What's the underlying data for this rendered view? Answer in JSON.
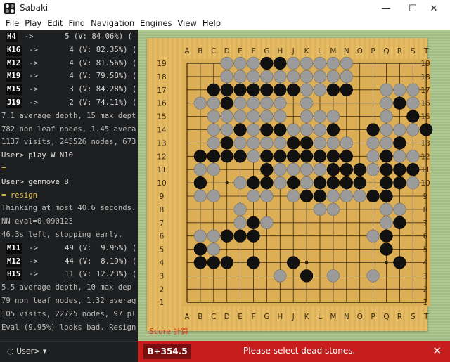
{
  "window": {
    "title": "Sabaki",
    "minimize": "—",
    "maximize": "☐",
    "close": "✕"
  },
  "menu": [
    "File",
    "Play",
    "Edit",
    "Find",
    "Navigation",
    "Engines",
    "View",
    "Help"
  ],
  "console": {
    "lines": [
      {
        "kind": "mv",
        "move": "H4",
        "text": "->       5 (V: 84.06%) ("
      },
      {
        "kind": "mv",
        "move": "K16",
        "text": "->       4 (V: 82.35%) ("
      },
      {
        "kind": "mv",
        "move": "M12",
        "text": "->       4 (V: 81.56%) ("
      },
      {
        "kind": "mv",
        "move": "M19",
        "text": "->       4 (V: 79.58%) ("
      },
      {
        "kind": "mv",
        "move": "M15",
        "text": "->       3 (V: 84.28%) ("
      },
      {
        "kind": "mv",
        "move": "J19",
        "text": "->       2 (V: 74.11%) ("
      },
      {
        "kind": "dim",
        "text": "7.1 average depth, 15 max dept"
      },
      {
        "kind": "dim",
        "text": "782 non leaf nodes, 1.45 avera"
      },
      {
        "kind": "dim",
        "text": "1137 visits, 245526 nodes, 673"
      },
      {
        "kind": "usr",
        "text": "User> play W N10"
      },
      {
        "kind": "eq",
        "text": "="
      },
      {
        "kind": "usr",
        "text": "User> genmove B"
      },
      {
        "kind": "resp",
        "text": "= resign"
      },
      {
        "kind": "dim",
        "text": "Thinking at most 40.6 seconds."
      },
      {
        "kind": "dim",
        "text": "NN eval=0.090123"
      },
      {
        "kind": "dim",
        "text": "46.3s left, stopping early."
      },
      {
        "kind": "mv",
        "move": "M11",
        "text": "->      49 (V:  9.95%) ("
      },
      {
        "kind": "mv",
        "move": "M12",
        "text": "->      44 (V:  8.19%) ("
      },
      {
        "kind": "mv",
        "move": "H15",
        "text": "->      11 (V: 12.23%) ("
      },
      {
        "kind": "dim",
        "text": "5.5 average depth, 10 max dep"
      },
      {
        "kind": "dim",
        "text": "79 non leaf nodes, 1.32 averag"
      },
      {
        "kind": "dim",
        "text": "105 visits, 22725 nodes, 97 pl"
      },
      {
        "kind": "dim",
        "text": "Eval (9.95%) looks bad. Resign"
      }
    ],
    "prompt": "○ User> ▾"
  },
  "board": {
    "size": 19,
    "columns": [
      "A",
      "B",
      "C",
      "D",
      "E",
      "F",
      "G",
      "H",
      "J",
      "K",
      "L",
      "M",
      "N",
      "O",
      "P",
      "Q",
      "R",
      "S",
      "T"
    ],
    "rows": [
      "19",
      "18",
      "17",
      "16",
      "15",
      "14",
      "13",
      "12",
      "11",
      "10",
      "9",
      "8",
      "7",
      "6",
      "5",
      "4",
      "3",
      "2",
      "1"
    ],
    "stones": {
      "19": {
        "black": [
          "G",
          "H"
        ],
        "dead": [
          "D",
          "E",
          "F",
          "J",
          "K",
          "L",
          "M",
          "N"
        ]
      },
      "18": {
        "black": [],
        "dead": [
          "D",
          "E",
          "F",
          "G",
          "H",
          "J",
          "K",
          "L",
          "M",
          "N"
        ]
      },
      "17": {
        "black": [
          "C",
          "D",
          "E",
          "F",
          "G",
          "H",
          "J",
          "M",
          "N"
        ],
        "dead": [
          "K",
          "L",
          "Q",
          "R",
          "S"
        ]
      },
      "16": {
        "black": [
          "D",
          "R"
        ],
        "dead": [
          "B",
          "C",
          "E",
          "F",
          "G",
          "H",
          "K",
          "Q",
          "S"
        ]
      },
      "15": {
        "black": [
          "S"
        ],
        "dead": [
          "C",
          "D",
          "E",
          "F",
          "G",
          "H",
          "K",
          "L",
          "M",
          "Q"
        ]
      },
      "14": {
        "black": [
          "E",
          "G",
          "H",
          "M",
          "P",
          "T"
        ],
        "dead": [
          "C",
          "D",
          "F",
          "J",
          "K",
          "L",
          "Q",
          "R",
          "S"
        ]
      },
      "13": {
        "black": [
          "D",
          "J",
          "K",
          "R"
        ],
        "dead": [
          "C",
          "E",
          "F",
          "G",
          "H",
          "L",
          "M",
          "N",
          "P",
          "Q"
        ]
      },
      "12": {
        "black": [
          "B",
          "C",
          "D",
          "E",
          "G",
          "H",
          "J",
          "K",
          "L",
          "M",
          "N",
          "Q"
        ],
        "dead": [
          "F",
          "P",
          "R",
          "S"
        ]
      },
      "11": {
        "black": [
          "G",
          "M",
          "N",
          "O",
          "Q",
          "R",
          "S"
        ],
        "dead": [
          "B",
          "C",
          "H",
          "J",
          "K",
          "L",
          "P"
        ]
      },
      "10": {
        "black": [
          "B",
          "F",
          "G",
          "J",
          "L",
          "M",
          "N",
          "O",
          "Q",
          "R"
        ],
        "dead": [
          "E",
          "H",
          "K",
          "S"
        ]
      },
      "9": {
        "black": [
          "K",
          "L",
          "P",
          "Q"
        ],
        "dead": [
          "B",
          "C",
          "F",
          "G",
          "J",
          "M",
          "N",
          "O"
        ]
      },
      "8": {
        "black": [],
        "dead": [
          "E",
          "L",
          "M",
          "Q",
          "R"
        ]
      },
      "7": {
        "black": [
          "F",
          "R"
        ],
        "dead": [
          "E",
          "G",
          "Q"
        ]
      },
      "6": {
        "black": [
          "D",
          "E",
          "F",
          "Q"
        ],
        "dead": [
          "B",
          "C",
          "P"
        ]
      },
      "5": {
        "black": [
          "B",
          "Q"
        ],
        "dead": [
          "C"
        ]
      },
      "4": {
        "black": [
          "B",
          "C",
          "D",
          "F",
          "J",
          "R"
        ],
        "dead": []
      },
      "3": {
        "black": [
          "K"
        ],
        "dead": [
          "H",
          "M",
          "P"
        ]
      },
      "2": {
        "black": [],
        "dead": []
      },
      "1": {
        "black": [],
        "dead": []
      }
    }
  },
  "score_tag": "Score 計算",
  "status": {
    "score": "B+354.5",
    "message": "Please select dead stones.",
    "close": "✕"
  },
  "colors": {
    "accent_red": "#c61d1d",
    "board_wood": "#e3b85f",
    "console_bg": "#1e1f20"
  }
}
